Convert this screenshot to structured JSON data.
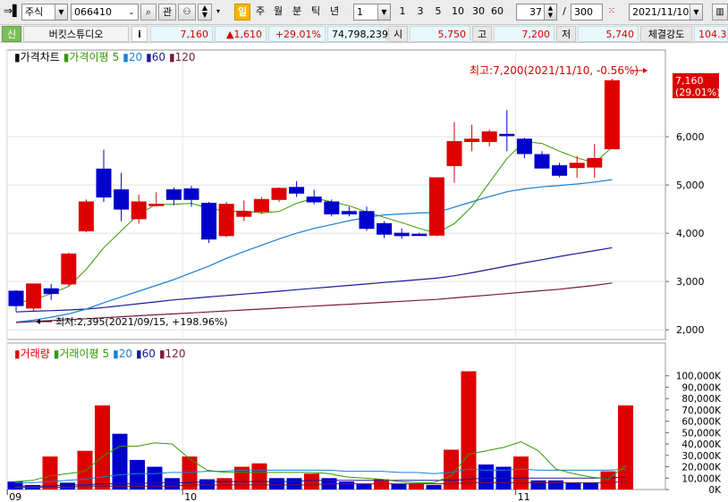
{
  "toolbar": {
    "market_type": "주식",
    "code": "066410",
    "btn_search": "⌕",
    "btn_watch": "관",
    "periods": [
      "일",
      "주",
      "월",
      "분",
      "틱",
      "년"
    ],
    "active_period": "일",
    "unit_value": "1",
    "interval_buttons": [
      "1",
      "3",
      "5",
      "10",
      "30",
      "60"
    ],
    "count_value": "37",
    "count_sep": "/",
    "count_total": "300",
    "date_value": "2021/11/10"
  },
  "info": {
    "market_badge": "신",
    "name": "버킷스튜디오",
    "info_button": "i",
    "price": "7,160",
    "change": "▲1,610",
    "change_pct": "+29.01%",
    "volume": "74,798,239",
    "open_label": "시",
    "open": "5,750",
    "high_label": "고",
    "high": "7,200",
    "low_label": "저",
    "low": "5,740",
    "strength_label": "체결강도",
    "strength": "104.3"
  },
  "colors": {
    "up": "#dd0000",
    "down": "#0000cc",
    "ma5": "#339900",
    "ma20": "#1a7fd4",
    "ma60": "#1a1a99",
    "ma120": "#7a1a3a"
  },
  "chart_data": [
    {
      "type": "candlestick",
      "title": "가격차트",
      "legend": [
        {
          "name": "가격이평",
          "period": "5",
          "color": "#339900"
        },
        {
          "name": "",
          "period": "20",
          "color": "#1a7fd4"
        },
        {
          "name": "",
          "period": "60",
          "color": "#1a1a99"
        },
        {
          "name": "",
          "period": "120",
          "color": "#7a1a3a"
        }
      ],
      "ylim": [
        1800,
        7500
      ],
      "yticks": [
        2000,
        3000,
        4000,
        5000,
        6000
      ],
      "ytick_labels": [
        "2,000",
        "3,000",
        "4,000",
        "5,000",
        "6,000"
      ],
      "xtick_labels": [
        {
          "label": "09",
          "index": 0
        },
        {
          "label": "10",
          "index": 10
        },
        {
          "label": "11",
          "index": 29
        }
      ],
      "candles": [
        {
          "o": 2800,
          "h": 2820,
          "l": 2380,
          "c": 2500
        },
        {
          "o": 2450,
          "h": 2950,
          "l": 2395,
          "c": 2950
        },
        {
          "o": 2850,
          "h": 2950,
          "l": 2620,
          "c": 2750
        },
        {
          "o": 2950,
          "h": 3600,
          "l": 2900,
          "c": 3570
        },
        {
          "o": 4050,
          "h": 4700,
          "l": 4020,
          "c": 4650
        },
        {
          "o": 5330,
          "h": 5730,
          "l": 4650,
          "c": 4750
        },
        {
          "o": 4900,
          "h": 5250,
          "l": 4250,
          "c": 4500
        },
        {
          "o": 4300,
          "h": 4800,
          "l": 4200,
          "c": 4650
        },
        {
          "o": 4580,
          "h": 4850,
          "l": 4550,
          "c": 4600
        },
        {
          "o": 4900,
          "h": 4950,
          "l": 4580,
          "c": 4700
        },
        {
          "o": 4920,
          "h": 4980,
          "l": 4550,
          "c": 4700
        },
        {
          "o": 4620,
          "h": 4650,
          "l": 3800,
          "c": 3880
        },
        {
          "o": 3950,
          "h": 4650,
          "l": 3920,
          "c": 4600
        },
        {
          "o": 4350,
          "h": 4680,
          "l": 4250,
          "c": 4450
        },
        {
          "o": 4450,
          "h": 4750,
          "l": 4400,
          "c": 4700
        },
        {
          "o": 4700,
          "h": 4950,
          "l": 4650,
          "c": 4930
        },
        {
          "o": 4950,
          "h": 5080,
          "l": 4750,
          "c": 4830
        },
        {
          "o": 4750,
          "h": 4900,
          "l": 4600,
          "c": 4650
        },
        {
          "o": 4650,
          "h": 4700,
          "l": 4350,
          "c": 4400
        },
        {
          "o": 4450,
          "h": 4550,
          "l": 4350,
          "c": 4400
        },
        {
          "o": 4450,
          "h": 4550,
          "l": 4050,
          "c": 4100
        },
        {
          "o": 4200,
          "h": 4250,
          "l": 3900,
          "c": 3980
        },
        {
          "o": 4000,
          "h": 4100,
          "l": 3880,
          "c": 3950
        },
        {
          "o": 3980,
          "h": 4010,
          "l": 3950,
          "c": 3960
        },
        {
          "o": 3960,
          "h": 5150,
          "l": 3940,
          "c": 5150
        },
        {
          "o": 5400,
          "h": 6300,
          "l": 5050,
          "c": 5900
        },
        {
          "o": 5900,
          "h": 6250,
          "l": 5700,
          "c": 5950
        },
        {
          "o": 5900,
          "h": 6150,
          "l": 5800,
          "c": 6100
        },
        {
          "o": 6050,
          "h": 6550,
          "l": 5700,
          "c": 6030
        },
        {
          "o": 5950,
          "h": 5980,
          "l": 5550,
          "c": 5650
        },
        {
          "o": 5630,
          "h": 5700,
          "l": 5350,
          "c": 5350
        },
        {
          "o": 5400,
          "h": 5460,
          "l": 5160,
          "c": 5200
        },
        {
          "o": 5360,
          "h": 5600,
          "l": 5150,
          "c": 5450
        },
        {
          "o": 5370,
          "h": 5850,
          "l": 5150,
          "c": 5550
        },
        {
          "o": 5750,
          "h": 7200,
          "l": 5740,
          "c": 7160
        }
      ],
      "ma5": [
        2560,
        2620,
        2750,
        2900,
        3250,
        3700,
        4050,
        4400,
        4600,
        4600,
        4620,
        4520,
        4450,
        4460,
        4420,
        4450,
        4620,
        4730,
        4650,
        4570,
        4440,
        4330,
        4220,
        4100,
        4000,
        4200,
        4550,
        5050,
        5550,
        5900,
        5860,
        5700,
        5560,
        5460,
        5780
      ],
      "ma20": [
        2160,
        2200,
        2260,
        2330,
        2430,
        2560,
        2680,
        2800,
        2920,
        3040,
        3180,
        3320,
        3480,
        3620,
        3750,
        3880,
        4000,
        4100,
        4180,
        4260,
        4330,
        4380,
        4400,
        4420,
        4430,
        4540,
        4650,
        4760,
        4860,
        4920,
        4960,
        4990,
        5020,
        5060,
        5110
      ],
      "ma60": [
        2370,
        2385,
        2395,
        2410,
        2430,
        2460,
        2500,
        2540,
        2580,
        2620,
        2650,
        2680,
        2710,
        2740,
        2770,
        2800,
        2830,
        2860,
        2890,
        2920,
        2950,
        2980,
        3010,
        3040,
        3070,
        3120,
        3180,
        3250,
        3320,
        3390,
        3450,
        3520,
        3580,
        3640,
        3700
      ],
      "ma120": [
        2150,
        2170,
        2190,
        2210,
        2230,
        2250,
        2270,
        2290,
        2310,
        2330,
        2350,
        2370,
        2390,
        2410,
        2430,
        2450,
        2470,
        2490,
        2510,
        2530,
        2550,
        2570,
        2590,
        2610,
        2630,
        2660,
        2690,
        2720,
        2750,
        2780,
        2810,
        2840,
        2880,
        2920,
        2970
      ],
      "annotations": [
        {
          "text": "최고:7,200(2021/11/10, -0.56%)",
          "value": 7200,
          "index": 34,
          "color": "#dd0000"
        },
        {
          "text": "최저:2,395(2021/09/15, +198.96%)",
          "value": 2395,
          "index": 1,
          "color": "#000000"
        }
      ],
      "last_price_label": "7,160",
      "last_change_label": "(29.01%)"
    },
    {
      "type": "bar",
      "title": "거래량",
      "legend": [
        {
          "name": "거래이평",
          "period": "5",
          "color": "#339900"
        },
        {
          "name": "",
          "period": "20",
          "color": "#1a7fd4"
        },
        {
          "name": "",
          "period": "60",
          "color": "#1a1a99"
        },
        {
          "name": "",
          "period": "120",
          "color": "#7a1a3a"
        }
      ],
      "ylim": [
        0,
        110000
      ],
      "yticks": [
        0,
        10000,
        20000,
        30000,
        40000,
        50000,
        60000,
        70000,
        80000,
        90000,
        100000
      ],
      "ytick_labels": [
        "0K",
        "10,000K",
        "20,000K",
        "30,000K",
        "40,000K",
        "50,000K",
        "60,000K",
        "70,000K",
        "80,000K",
        "90,000K",
        "100,000K"
      ],
      "volumes": [
        7000,
        4000,
        29000,
        6000,
        34000,
        74000,
        49000,
        26000,
        20000,
        10000,
        29000,
        9000,
        10000,
        20000,
        23000,
        10000,
        10000,
        14000,
        10000,
        7000,
        5000,
        9000,
        5000,
        5000,
        4000,
        35000,
        104000,
        22000,
        20000,
        29000,
        8000,
        8000,
        6000,
        6000,
        16000,
        74000
      ],
      "up": [
        false,
        false,
        true,
        false,
        true,
        true,
        false,
        false,
        false,
        false,
        true,
        false,
        true,
        true,
        true,
        false,
        false,
        true,
        false,
        false,
        false,
        true,
        false,
        true,
        false,
        true,
        true,
        false,
        false,
        true,
        false,
        false,
        false,
        false,
        true,
        true
      ],
      "vma5": [
        7000,
        8000,
        12000,
        14000,
        16000,
        29000,
        38000,
        38000,
        41000,
        40000,
        27000,
        17000,
        15000,
        15000,
        15000,
        15000,
        15000,
        15000,
        14000,
        11000,
        10000,
        9000,
        7000,
        6000,
        6000,
        12000,
        31000,
        34000,
        37000,
        42000,
        34000,
        18000,
        14000,
        11000,
        9000,
        21000
      ],
      "vma20": [
        6000,
        6000,
        7000,
        8000,
        9000,
        11000,
        13000,
        14000,
        14000,
        15000,
        15000,
        16000,
        16000,
        17000,
        17000,
        17000,
        17000,
        17000,
        17000,
        16000,
        16000,
        16000,
        15000,
        15000,
        14000,
        15000,
        18000,
        17000,
        17000,
        18000,
        17000,
        17000,
        17000,
        17000,
        17000,
        18000
      ],
      "vma60": [
        3000,
        3000,
        3000,
        4000,
        4000,
        5000,
        5000,
        5000,
        6000,
        6000,
        6000,
        7000,
        7000,
        7000,
        7000,
        7000,
        7000,
        8000,
        8000,
        8000,
        8000,
        8000,
        8000,
        8000,
        8000,
        8000,
        9000,
        10000,
        10000,
        10000,
        10000,
        10000,
        10000,
        10000,
        10000,
        11000
      ],
      "vma120": [
        2000,
        2000,
        2000,
        2000,
        3000,
        3000,
        3000,
        3000,
        3000,
        3000,
        4000,
        4000,
        4000,
        4000,
        4000,
        4000,
        4000,
        4000,
        5000,
        5000,
        5000,
        5000,
        5000,
        5000,
        5000,
        5000,
        6000,
        6000,
        6000,
        6000,
        6000,
        6000,
        6000,
        6000,
        6000,
        7000
      ]
    }
  ]
}
